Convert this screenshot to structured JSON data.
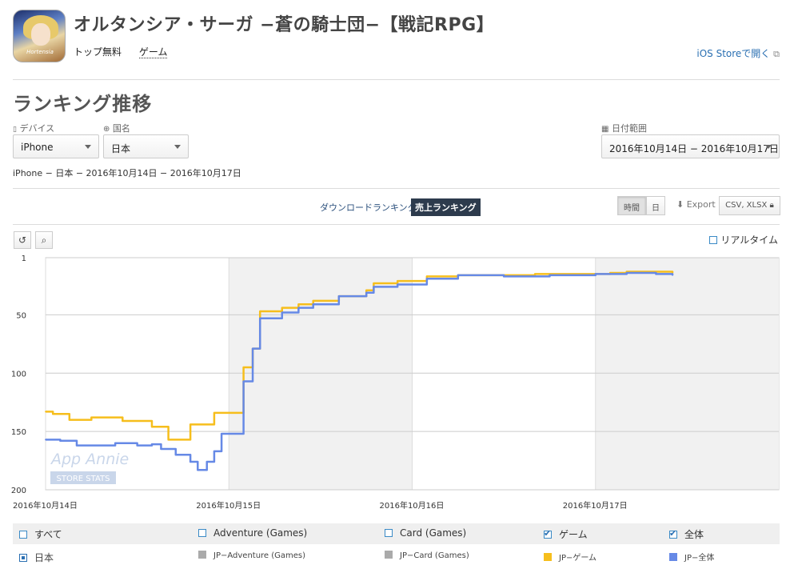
{
  "app": {
    "title": "オルタンシア・サーガ −蒼の騎士団−【戦記RPG】",
    "category": "トップ無料",
    "genre": "ゲーム",
    "store_link": "iOS Storeで開く",
    "icon_text": "Hortensia"
  },
  "section": {
    "title": "ランキング推移"
  },
  "filters": {
    "device_label": "デバイス",
    "device_value": "iPhone",
    "country_label": "国名",
    "country_value": "日本",
    "date_label": "日付範囲",
    "date_value": "2016年10月14日 − 2016年10月17日"
  },
  "summary": "iPhone − 日本 − 2016年10月14日 − 2016年10月17日",
  "tabs": {
    "download": "ダウンロードランキング",
    "sales": "売上ランキング",
    "hour": "時間",
    "day": "日",
    "export": "Export",
    "csv": "CSV, XLSX"
  },
  "realtime_label": "リアルタイム",
  "watermark": {
    "brand": "App Annie",
    "sub": "STORE STATS"
  },
  "chart_data": {
    "type": "line",
    "y_reversed": true,
    "ylim": [
      1,
      200
    ],
    "yticks": [
      "1",
      "50",
      "100",
      "150",
      "200"
    ],
    "ytick_values": [
      1,
      50,
      100,
      150,
      200
    ],
    "xlim": [
      0,
      4
    ],
    "xticks": [
      "2016年10月14日",
      "2016年10月15日",
      "2016年10月16日",
      "2016年10月17日"
    ],
    "xtick_values": [
      0,
      1,
      2,
      3
    ],
    "shaded_ranges": [
      [
        1,
        2
      ],
      [
        3,
        4
      ]
    ],
    "series": [
      {
        "name": "JP-ゲーム",
        "color": "#f6be1c",
        "points": [
          [
            0,
            133
          ],
          [
            0.04,
            135
          ],
          [
            0.13,
            140
          ],
          [
            0.25,
            138
          ],
          [
            0.42,
            141
          ],
          [
            0.58,
            146
          ],
          [
            0.67,
            157
          ],
          [
            0.79,
            144
          ],
          [
            0.92,
            134
          ],
          [
            1.04,
            134
          ],
          [
            1.08,
            95
          ],
          [
            1.13,
            79
          ],
          [
            1.17,
            47
          ],
          [
            1.29,
            44
          ],
          [
            1.38,
            41
          ],
          [
            1.46,
            38
          ],
          [
            1.6,
            34
          ],
          [
            1.75,
            29
          ],
          [
            1.79,
            23
          ],
          [
            1.92,
            21
          ],
          [
            2.08,
            17
          ],
          [
            2.25,
            16
          ],
          [
            2.5,
            16
          ],
          [
            2.67,
            15
          ],
          [
            2.75,
            15
          ],
          [
            2.83,
            15
          ],
          [
            3,
            15
          ],
          [
            3.08,
            14
          ],
          [
            3.17,
            13
          ],
          [
            3.25,
            13
          ],
          [
            3.38,
            13
          ],
          [
            3.42,
            14
          ]
        ]
      },
      {
        "name": "JP-全体",
        "color": "#6689e6",
        "points": [
          [
            0,
            157
          ],
          [
            0.08,
            158
          ],
          [
            0.17,
            162
          ],
          [
            0.25,
            162
          ],
          [
            0.38,
            160
          ],
          [
            0.5,
            162
          ],
          [
            0.58,
            161
          ],
          [
            0.63,
            165
          ],
          [
            0.71,
            170
          ],
          [
            0.79,
            176
          ],
          [
            0.83,
            183
          ],
          [
            0.88,
            176
          ],
          [
            0.92,
            167
          ],
          [
            0.96,
            152
          ],
          [
            1.04,
            152
          ],
          [
            1.08,
            107
          ],
          [
            1.13,
            79
          ],
          [
            1.17,
            53
          ],
          [
            1.25,
            53
          ],
          [
            1.29,
            48
          ],
          [
            1.38,
            44
          ],
          [
            1.46,
            41
          ],
          [
            1.6,
            34
          ],
          [
            1.75,
            31
          ],
          [
            1.79,
            26
          ],
          [
            1.92,
            24
          ],
          [
            2.08,
            19
          ],
          [
            2.25,
            16
          ],
          [
            2.5,
            17
          ],
          [
            2.58,
            17
          ],
          [
            2.67,
            17
          ],
          [
            2.75,
            16
          ],
          [
            3,
            15
          ],
          [
            3.08,
            15
          ],
          [
            3.17,
            14
          ],
          [
            3.25,
            14
          ],
          [
            3.33,
            15
          ],
          [
            3.42,
            16
          ]
        ]
      }
    ]
  },
  "legend": {
    "row1": [
      {
        "label": "すべて",
        "checked": false
      },
      {
        "label": "Adventure (Games)",
        "checked": false
      },
      {
        "label": "Card (Games)",
        "checked": false
      },
      {
        "label": "ゲーム",
        "checked": true
      },
      {
        "label": "全体",
        "checked": true
      }
    ],
    "row2": [
      {
        "label": "日本",
        "color": "#2a6fb2"
      },
      {
        "label": "JP−Adventure (Games)",
        "color": "#aaaaaa"
      },
      {
        "label": "JP−Card (Games)",
        "color": "#aaaaaa"
      },
      {
        "label": "JP−ゲーム",
        "color": "#f6be1c"
      },
      {
        "label": "JP−全体",
        "color": "#6689e6"
      }
    ]
  }
}
